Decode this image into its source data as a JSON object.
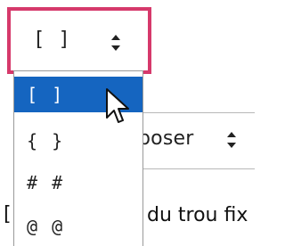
{
  "select": {
    "value": "[ ]",
    "focus_color": "#d6396b"
  },
  "dropdown": {
    "options": [
      {
        "label": "[ ]",
        "selected": true
      },
      {
        "label": "{ }",
        "selected": false
      },
      {
        "label": "# #",
        "selected": false
      },
      {
        "label": "@ @",
        "selected": false
      }
    ],
    "highlight_color": "#1565c0"
  },
  "background": {
    "select_label": "poser",
    "text_fragment": "du trou fix",
    "bracket_fragment": "["
  },
  "icons": {
    "select_arrow": "updown-chevron-icon",
    "cursor": "mouse-pointer-icon"
  }
}
